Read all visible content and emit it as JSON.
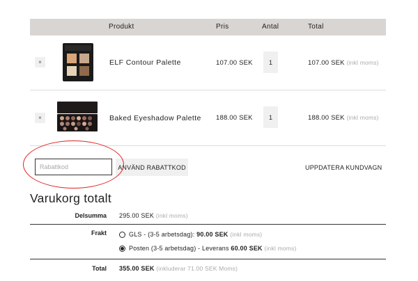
{
  "header": {
    "product": "Produkt",
    "price": "Pris",
    "quantity": "Antal",
    "total": "Total"
  },
  "cart": [
    {
      "remove": "×",
      "name": "ELF Contour Palette",
      "price": "107.00 SEK",
      "qty": "1",
      "total": "107.00 SEK",
      "tax_note": "(inkl moms)"
    },
    {
      "remove": "×",
      "name": "Baked Eyeshadow Palette",
      "price": "188.00 SEK",
      "qty": "1",
      "total": "188.00 SEK",
      "tax_note": "(inkl moms)"
    }
  ],
  "coupon": {
    "placeholder": "Rabattkod",
    "apply_label": "ANVÄND RABATTKOD",
    "update_label": "UPPDATERA KUNDVAGN"
  },
  "totals": {
    "title": "Varukorg totalt",
    "subtotal_label": "Delsumma",
    "subtotal_value": "295.00 SEK",
    "subtotal_note": "(inkl moms)",
    "shipping_label": "Frakt",
    "shipping_options": [
      {
        "text": "GLS - (3-5 arbetsdag):",
        "price": "90.00 SEK",
        "note": "(inkl moms)",
        "selected": false
      },
      {
        "text": "Posten (3-5 arbetsdag) - Leverans",
        "price": "60.00 SEK",
        "note": "(inkl moms)",
        "selected": true
      }
    ],
    "total_label": "Total",
    "total_value": "355.00 SEK",
    "total_note": "(inkluderar 71.00 SEK Moms)"
  },
  "colors": {
    "header_bg": "#d9d5d3",
    "highlight_circle": "#e02020"
  }
}
